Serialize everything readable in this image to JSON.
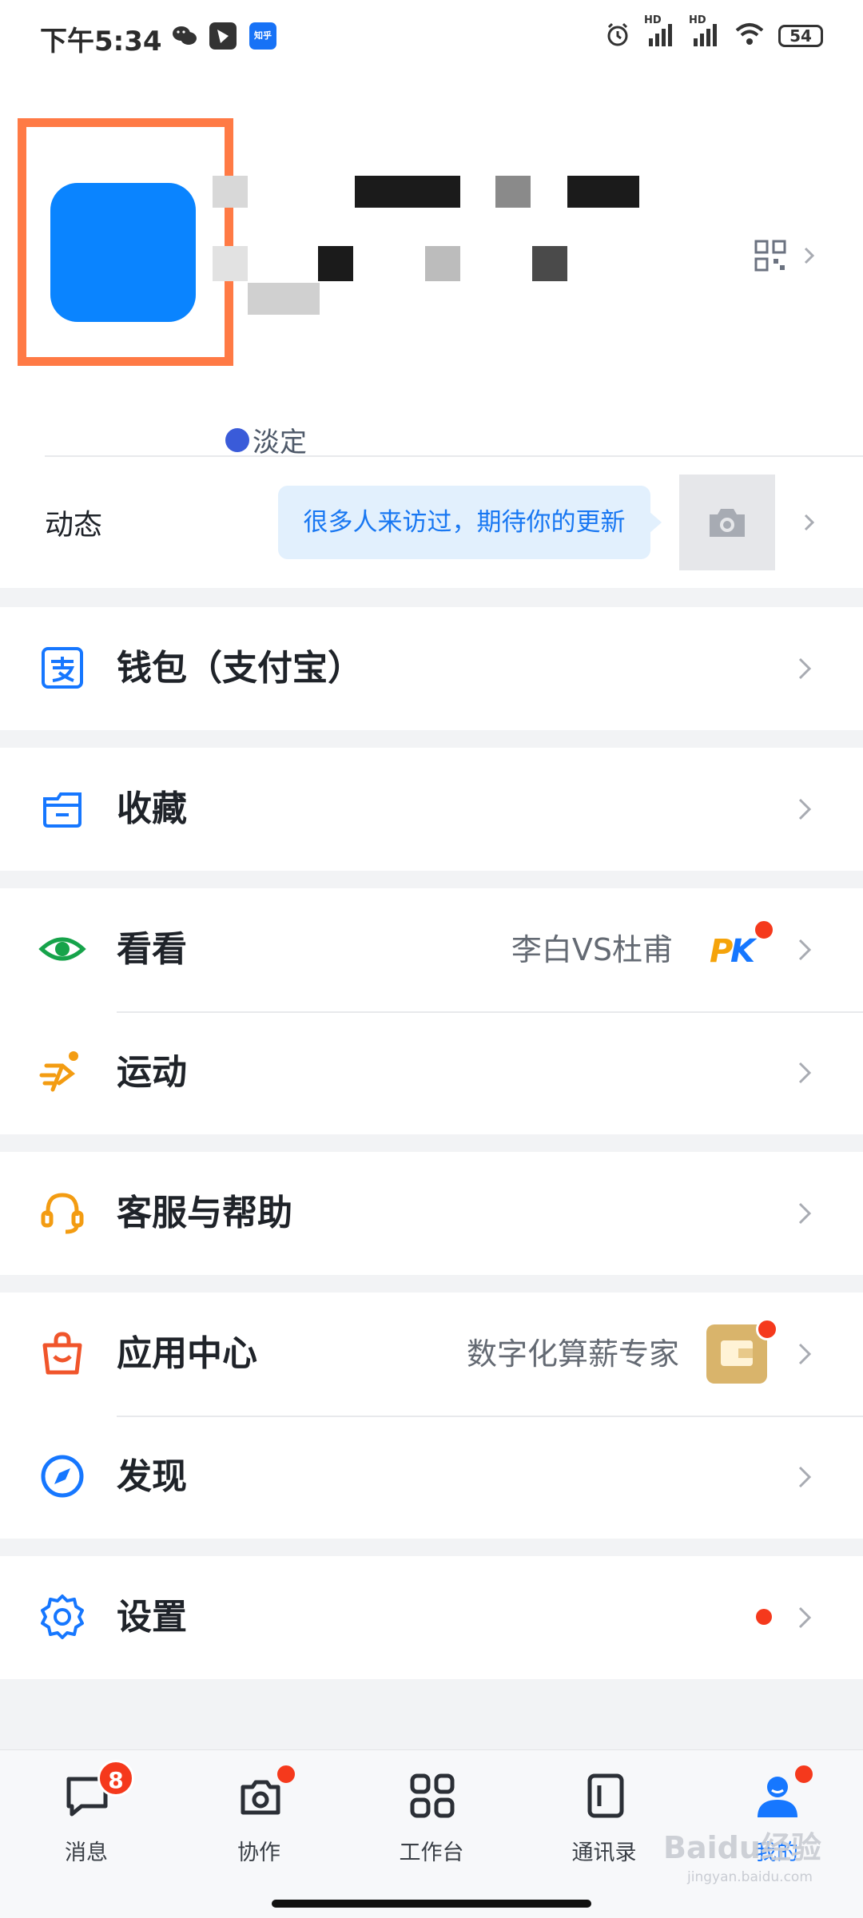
{
  "status_bar": {
    "time": "下午5:34",
    "hd1": "HD",
    "hd2": "HD",
    "battery": "54",
    "app_icons": [
      "wechat-icon",
      "feishu-icon",
      "zhihu-icon"
    ],
    "zhihu_label": "知乎"
  },
  "profile": {
    "status": "淡定",
    "qr_icon": "qr-code-icon"
  },
  "moments": {
    "label": "动态",
    "hint": "很多人来访过，期待你的更新"
  },
  "menu": {
    "wallet": {
      "label": "钱包（支付宝）",
      "icon": "alipay-icon"
    },
    "favorites": {
      "label": "收藏",
      "icon": "folder-icon"
    },
    "watch": {
      "label": "看看",
      "extra": "李白VS杜甫",
      "icon": "eye-icon",
      "badge_text": "PK"
    },
    "sports": {
      "label": "运动",
      "icon": "running-icon"
    },
    "support": {
      "label": "客服与帮助",
      "icon": "headset-icon"
    },
    "app_center": {
      "label": "应用中心",
      "extra": "数字化算薪专家",
      "icon": "shopping-bag-icon"
    },
    "discover": {
      "label": "发现",
      "icon": "compass-icon"
    },
    "settings": {
      "label": "设置",
      "icon": "gear-icon"
    }
  },
  "tabs": [
    {
      "label": "消息",
      "icon": "message-icon",
      "badge": "8"
    },
    {
      "label": "协作",
      "icon": "collaborate-icon"
    },
    {
      "label": "工作台",
      "icon": "grid-icon"
    },
    {
      "label": "通讯录",
      "icon": "contacts-icon"
    },
    {
      "label": "我的",
      "icon": "person-icon"
    }
  ],
  "colors": {
    "accent": "#1677ff",
    "badge": "#f5391c",
    "avatar_frame": "#ff7a45",
    "eye_green": "#16a34a",
    "sport_orange": "#f39c12"
  },
  "watermark": {
    "text": "Baidu经验",
    "sub": "jingyan.baidu.com"
  }
}
